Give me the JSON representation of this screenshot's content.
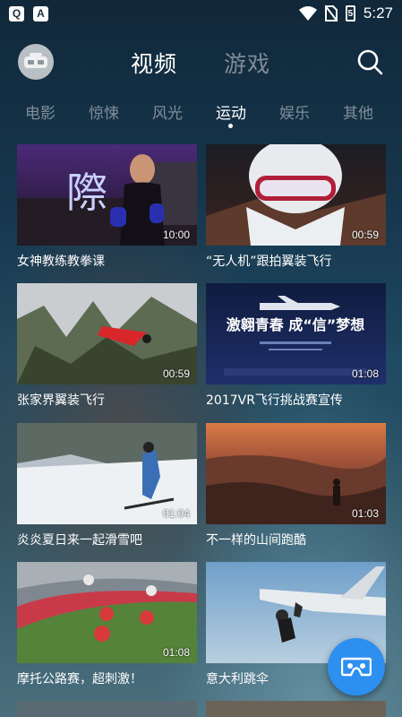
{
  "status_bar": {
    "time": "5:27",
    "battery_level": "5"
  },
  "header": {
    "tab_video": "视频",
    "tab_game": "游戏"
  },
  "categories": [
    "电影",
    "惊悚",
    "风光",
    "运动",
    "娱乐",
    "其他"
  ],
  "active_category": "运动",
  "videos": [
    {
      "title": "女神教练教拳课",
      "duration": "10:00"
    },
    {
      "title": "“无人机”跟拍翼装飞行",
      "duration": "00:59"
    },
    {
      "title": "张家界翼装飞行",
      "duration": "00:59"
    },
    {
      "title": "2017VR飞行挑战赛宣传",
      "duration": "01:08"
    },
    {
      "title": "炎炎夏日来一起滑雪吧",
      "duration": "01:04"
    },
    {
      "title": "不一样的山间跑酷",
      "duration": "01:03"
    },
    {
      "title": "摩托公路赛，超刺激！",
      "duration": "01:08"
    },
    {
      "title": "意大利跳伞",
      "duration": ""
    }
  ],
  "thumb_texts": {
    "vr_poster_title": "激翱青春 成“信”梦想",
    "gym_sign": "際"
  },
  "colors": {
    "fab": "#2d8ff0",
    "background": "#16364d"
  },
  "icons": {
    "fab": "vr-headset-icon",
    "search": "search-icon"
  }
}
